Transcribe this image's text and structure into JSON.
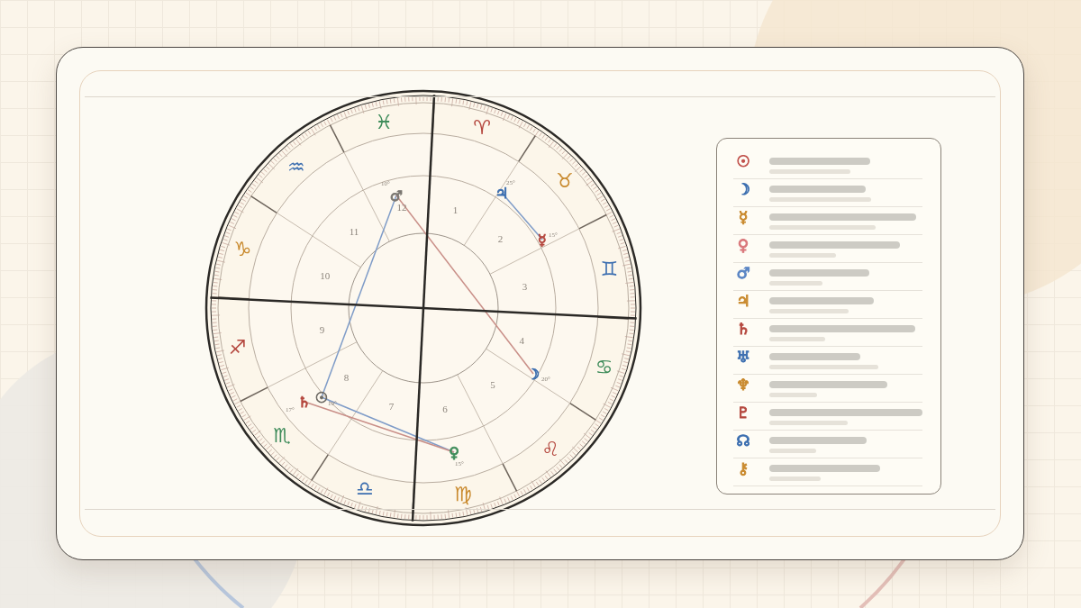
{
  "signs": [
    {
      "glyph": "♈",
      "color": "#b5483f"
    },
    {
      "glyph": "♉",
      "color": "#c98a2e"
    },
    {
      "glyph": "♊",
      "color": "#3d6fb0"
    },
    {
      "glyph": "♋",
      "color": "#3e8c5a"
    },
    {
      "glyph": "♌",
      "color": "#b5483f"
    },
    {
      "glyph": "♍",
      "color": "#c98a2e"
    },
    {
      "glyph": "♎",
      "color": "#3d6fb0"
    },
    {
      "glyph": "♏",
      "color": "#3e8c5a"
    },
    {
      "glyph": "♐",
      "color": "#b5483f"
    },
    {
      "glyph": "♑",
      "color": "#c98a2e"
    },
    {
      "glyph": "♒",
      "color": "#3d6fb0"
    },
    {
      "glyph": "♓",
      "color": "#3e8c5a"
    }
  ],
  "houses": [
    "1",
    "2",
    "3",
    "4",
    "5",
    "6",
    "7",
    "8",
    "9",
    "10",
    "11",
    "12"
  ],
  "planets": [
    {
      "glyph": "♂",
      "color": "#7a7670",
      "degree": "10°"
    },
    {
      "glyph": "♃",
      "color": "#3d6fb0",
      "degree": "25°"
    },
    {
      "glyph": "☿",
      "color": "#b5483f",
      "degree": "15°"
    },
    {
      "glyph": "☽",
      "color": "#3d6fb0",
      "degree": "20°"
    },
    {
      "glyph": "♀",
      "color": "#3e8c5a",
      "degree": "15°"
    },
    {
      "glyph": "♄",
      "color": "#b5483f",
      "degree": "17°"
    },
    {
      "glyph": "☉",
      "color": "#6d6a64",
      "degree": "19°"
    }
  ],
  "legend": [
    {
      "glyph": "☉",
      "color": "#c0504a"
    },
    {
      "glyph": "☽",
      "color": "#3d6fb0"
    },
    {
      "glyph": "☿",
      "color": "#c98a2e"
    },
    {
      "glyph": "♀",
      "color": "#d9767a"
    },
    {
      "glyph": "♂",
      "color": "#5a85c4"
    },
    {
      "glyph": "♃",
      "color": "#c98a2e"
    },
    {
      "glyph": "♄",
      "color": "#b5483f"
    },
    {
      "glyph": "♅",
      "color": "#3d6fb0"
    },
    {
      "glyph": "♆",
      "color": "#c98a2e"
    },
    {
      "glyph": "♇",
      "color": "#b5483f"
    },
    {
      "glyph": "☊",
      "color": "#3d6fb0"
    },
    {
      "glyph": "⚷",
      "color": "#c98a2e"
    }
  ]
}
